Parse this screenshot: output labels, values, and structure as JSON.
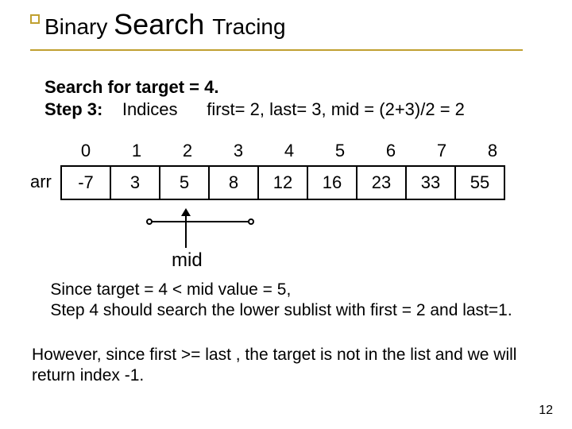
{
  "title": {
    "part1": "Binary ",
    "part2": "Search ",
    "part3": "Tracing"
  },
  "line_target": "Search for target = 4.",
  "step_label": "Step 3:",
  "step_word": "Indices",
  "step_rest": "first= 2, last= 3, mid = (2+3)/2 = 2",
  "arr_label": "arr",
  "indices": [
    "0",
    "1",
    "2",
    "3",
    "4",
    "5",
    "6",
    "7",
    "8"
  ],
  "values": [
    "-7",
    "3",
    "5",
    "8",
    "12",
    "16",
    "23",
    "33",
    "55"
  ],
  "mid_label": "mid",
  "para1": "    Since target = 4 < mid value = 5,\n    Step 4 should search the lower sublist with first = 2 and last=1.",
  "para2": "However, since first >= last , the target is not in the list and we will return index -1.",
  "slide_number": "12",
  "chart_data": {
    "type": "table",
    "title": "Binary Search Tracing — Step 3",
    "target": 4,
    "first": 2,
    "last": 3,
    "mid": 2,
    "mid_value": 5,
    "indices": [
      0,
      1,
      2,
      3,
      4,
      5,
      6,
      7,
      8
    ],
    "array": [
      -7,
      3,
      5,
      8,
      12,
      16,
      23,
      33,
      55
    ],
    "result_index": -1
  }
}
